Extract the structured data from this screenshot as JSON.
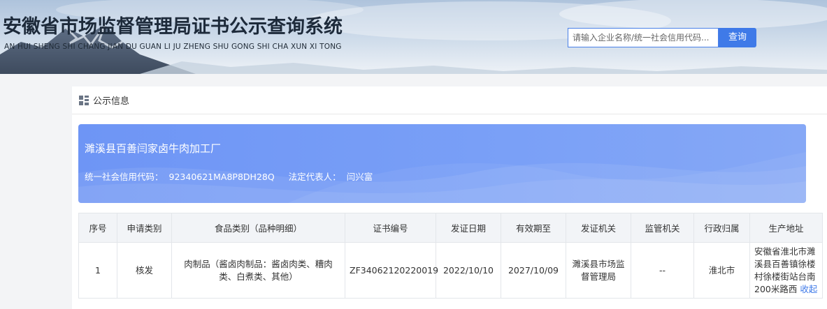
{
  "header": {
    "title": "安徽省市场监督管理局证书公示查询系统",
    "subtitle": "AN HUI SHENG SHI CHANG JIAN DU GUAN LI JU ZHENG SHU GONG SHI CHA XUN XI TONG",
    "search_placeholder": "请输入企业名称/统一社会信用代码...",
    "search_button": "查询"
  },
  "panel": {
    "title": "公示信息",
    "icon": "grid-list-icon"
  },
  "company": {
    "name": "濉溪县百善闫家卤牛肉加工厂",
    "credit_code_label": "统一社会信用代码：",
    "credit_code": "92340621MA8P8DH28Q",
    "legal_rep_label": "法定代表人：",
    "legal_rep": "闫兴富"
  },
  "table": {
    "headers": [
      "序号",
      "申请类别",
      "食品类别（品种明细）",
      "证书编号",
      "发证日期",
      "有效期至",
      "发证机关",
      "监管机关",
      "行政归属",
      "生产地址"
    ],
    "rows": [
      {
        "index": "1",
        "apply_type": "核发",
        "food_category": "肉制品（酱卤肉制品：酱卤肉类、糟肉类、白煮类、其他）",
        "cert_no": "ZF34062120220019",
        "issue_date": "2022/10/10",
        "valid_until": "2027/10/09",
        "issuer": "濉溪县市场监督管理局",
        "supervisor": "--",
        "region": "淮北市",
        "address": "安徽省淮北市濉溪县百善镇徐楼村徐楼街站台南200米路西",
        "collapse_label": "收起"
      }
    ]
  },
  "colors": {
    "accent": "#3f7ae8",
    "card_bg": "#7aa0f7",
    "page_bg": "#f3f4f6"
  }
}
